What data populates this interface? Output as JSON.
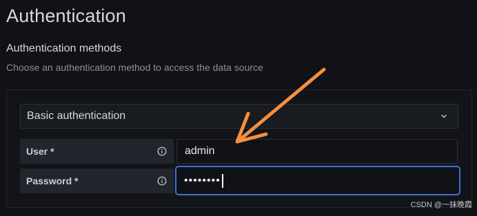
{
  "page": {
    "title": "Authentication"
  },
  "auth": {
    "section_title": "Authentication methods",
    "section_description": "Choose an authentication method to access the data source",
    "method_select": {
      "value": "Basic authentication",
      "icon": "chevron-down-icon"
    },
    "user": {
      "label": "User *",
      "value": "admin",
      "info_icon": "info-icon"
    },
    "password": {
      "label": "Password *",
      "value": "••••••••",
      "info_icon": "info-icon"
    }
  },
  "annotation": {
    "arrow_color": "#f4903f"
  },
  "watermark": {
    "text": "CSDN @一抹晚霞"
  },
  "colors": {
    "background": "#111217",
    "focus_border": "#3d71d9",
    "label_bg": "#22252b"
  }
}
